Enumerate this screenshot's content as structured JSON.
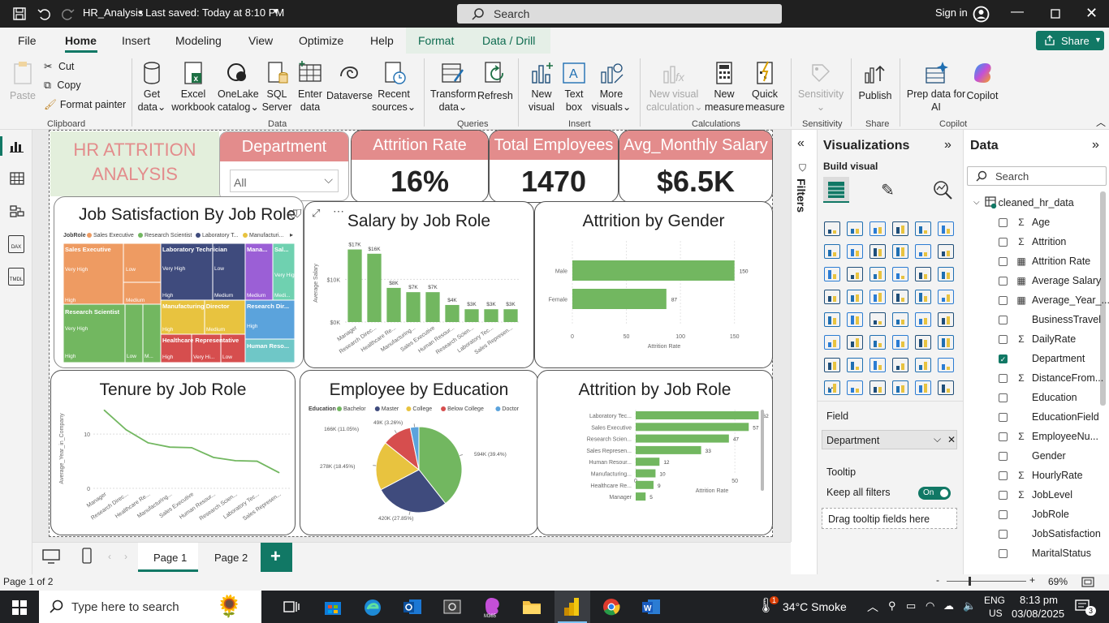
{
  "app": {
    "title": "HR_Analysis",
    "saved": "• Last saved: Today at 8:10 PM",
    "search": "Search",
    "signin": "Sign in"
  },
  "menu": {
    "file": "File",
    "home": "Home",
    "insert": "Insert",
    "modeling": "Modeling",
    "view": "View",
    "optimize": "Optimize",
    "help": "Help",
    "format": "Format",
    "datadrill": "Data / Drill",
    "share": "Share"
  },
  "ribbon": {
    "paste": "Paste",
    "cut": "Cut",
    "copy": "Copy",
    "format_painter": "Format painter",
    "clipboard": "Clipboard",
    "get_data_1": "Get",
    "get_data_2": "data",
    "excel_1": "Excel",
    "excel_2": "workbook",
    "onelake_1": "OneLake",
    "onelake_2": "catalog",
    "sql_1": "SQL",
    "sql_2": "Server",
    "enter_1": "Enter",
    "enter_2": "data",
    "dataverse": "Dataverse",
    "recent_1": "Recent",
    "recent_2": "sources",
    "data": "Data",
    "transform_1": "Transform",
    "transform_2": "data",
    "refresh": "Refresh",
    "queries": "Queries",
    "newvis_1": "New",
    "newvis_2": "visual",
    "textbox_1": "Text",
    "textbox_2": "box",
    "morevis_1": "More",
    "morevis_2": "visuals",
    "insert": "Insert",
    "newcalc_1": "New visual",
    "newcalc_2": "calculation",
    "newmeas_1": "New",
    "newmeas_2": "measure",
    "quickmeas_1": "Quick",
    "quickmeas_2": "measure",
    "calculations": "Calculations",
    "sensitivity": "Sensitivity",
    "sensitivity_grp": "Sensitivity",
    "publish": "Publish",
    "share_grp": "Share",
    "prep_1": "Prep data for",
    "prep_2": "AI",
    "copilot_btn": "Copilot",
    "copilot_grp": "Copilot"
  },
  "report": {
    "title_1": "HR ATTRITION",
    "title_2": "ANALYSIS",
    "dept_header": "Department",
    "dept_value": "All",
    "kpis": [
      {
        "label": "Attrition Rate",
        "value": "16%"
      },
      {
        "label": "Total Employees",
        "value": "1470"
      },
      {
        "label": "Avg_Monthly Salary",
        "value": "$6.5K"
      }
    ],
    "treemap": {
      "title": "Job Satisfaction By Job Role",
      "legend_label": "JobRole",
      "legend": [
        "Sales Executive",
        "Research Scientist",
        "Laboratory T...",
        "Manufacturi..."
      ],
      "labels": {
        "se": "Sales Executive",
        "lt": "Laboratory Technician",
        "ma": "Mana...",
        "sa": "Sal...",
        "rs": "Research Scientist",
        "md": "Manufacturing Director",
        "hr": "Healthcare Representative",
        "rd": "Research Dir...",
        "hu": "Human Reso...",
        "vh": "Very High",
        "lo": "Low",
        "hi": "High",
        "me": "Medium",
        "m": "M...",
        "vhl": "Very Hi...",
        "medi": "Medi..."
      }
    },
    "salary": {
      "title": "Salary by Job Role",
      "ylabel": "Average Salary",
      "yticks": [
        "$0K",
        "$10K"
      ]
    },
    "gender": {
      "title": "Attrition by Gender",
      "xlabel": "Attrition Rate",
      "xticks": [
        "0",
        "50",
        "100",
        "150"
      ]
    },
    "tenure": {
      "title": "Tenure by Job Role",
      "ylabel": "Average_Year_in_Company",
      "yticks": [
        "0",
        "10"
      ]
    },
    "education": {
      "title": "Employee by Education",
      "legend_label": "Education",
      "legend": [
        "Bachelor",
        "Master",
        "College",
        "Below College",
        "Doctor"
      ]
    },
    "jobattr": {
      "title": "Attrition by Job Role",
      "xlabel": "Attrition Rate",
      "xticks": [
        "0",
        "50"
      ]
    }
  },
  "chart_data": [
    {
      "type": "bar",
      "title": "Salary by Job Role",
      "ylabel": "Average Salary",
      "categories": [
        "Manager",
        "Research Direc...",
        "Healthcare Re...",
        "Manufacturing...",
        "Sales Executive",
        "Human Resour...",
        "Research Scien...",
        "Laboratory Tec...",
        "Sales Represen..."
      ],
      "values": [
        17,
        16,
        8,
        7,
        7,
        4,
        3,
        3,
        3
      ],
      "data_labels": [
        "$17K",
        "$16K",
        "$8K",
        "$7K",
        "$7K",
        "$4K",
        "$3K",
        "$3K",
        "$3K"
      ],
      "ylim": [
        0,
        19
      ]
    },
    {
      "type": "bar",
      "orientation": "horizontal",
      "title": "Attrition by Gender",
      "xlabel": "Attrition Rate",
      "categories": [
        "Male",
        "Female"
      ],
      "values": [
        150,
        87
      ],
      "xlim": [
        0,
        160
      ]
    },
    {
      "type": "line",
      "title": "Tenure by Job Role",
      "ylabel": "Average_Year_in_Company",
      "categories": [
        "Manager",
        "Research Direc...",
        "Healthcare Re...",
        "Manufacturing...",
        "Sales Executive",
        "Human Resour...",
        "Research Scien...",
        "Laboratory Tec...",
        "Sales Represen..."
      ],
      "values": [
        14.4,
        10.8,
        8.4,
        7.6,
        7.5,
        5.7,
        5.1,
        5.0,
        2.9
      ],
      "ylim": [
        0,
        16
      ]
    },
    {
      "type": "pie",
      "title": "Employee by Education",
      "categories": [
        "Bachelor",
        "Master",
        "College",
        "Below College",
        "Doctor"
      ],
      "values": [
        594,
        420,
        278,
        166,
        49
      ],
      "data_labels": [
        "594K (39.4%)",
        "420K (27.85%)",
        "278K (18.45%)",
        "166K (11.05%)",
        "49K (3.26%)"
      ],
      "colors": [
        "#72b760",
        "#3f4b7d",
        "#e8c33f",
        "#d64e4e",
        "#5ba3dc"
      ]
    },
    {
      "type": "bar",
      "orientation": "horizontal",
      "title": "Attrition by Job Role",
      "xlabel": "Attrition Rate",
      "categories": [
        "Laboratory Tec...",
        "Sales Executive",
        "Research Scien...",
        "Sales Represen...",
        "Human Resour...",
        "Manufacturing...",
        "Healthcare Re...",
        "Manager"
      ],
      "values": [
        62,
        57,
        47,
        33,
        12,
        10,
        9,
        5
      ],
      "xlim": [
        0,
        70
      ]
    }
  ],
  "filters": {
    "label": "Filters"
  },
  "viz": {
    "title": "Visualizations",
    "build": "Build visual",
    "field_label": "Field",
    "field_value": "Department",
    "tooltip": "Tooltip",
    "keep": "Keep all filters",
    "toggle": "On",
    "drag": "Drag tooltip fields here",
    "more": "..."
  },
  "datapane": {
    "title": "Data",
    "search": "Search",
    "table": "cleaned_hr_data",
    "fields": [
      {
        "n": "Age",
        "s": "Σ",
        "c": false
      },
      {
        "n": "Attrition",
        "s": "Σ",
        "c": false
      },
      {
        "n": "Attrition Rate",
        "s": "▦",
        "c": false
      },
      {
        "n": "Average Salary",
        "s": "▦",
        "c": false
      },
      {
        "n": "Average_Year_...",
        "s": "▦",
        "c": false
      },
      {
        "n": "BusinessTravel",
        "s": "",
        "c": false
      },
      {
        "n": "DailyRate",
        "s": "Σ",
        "c": false
      },
      {
        "n": "Department",
        "s": "",
        "c": true
      },
      {
        "n": "DistanceFrom...",
        "s": "Σ",
        "c": false
      },
      {
        "n": "Education",
        "s": "",
        "c": false
      },
      {
        "n": "EducationField",
        "s": "",
        "c": false
      },
      {
        "n": "EmployeeNu...",
        "s": "Σ",
        "c": false
      },
      {
        "n": "Gender",
        "s": "",
        "c": false
      },
      {
        "n": "HourlyRate",
        "s": "Σ",
        "c": false
      },
      {
        "n": "JobLevel",
        "s": "Σ",
        "c": false
      },
      {
        "n": "JobRole",
        "s": "",
        "c": false
      },
      {
        "n": "JobSatisfaction",
        "s": "",
        "c": false
      },
      {
        "n": "MaritalStatus",
        "s": "",
        "c": false
      }
    ]
  },
  "pages": {
    "p1": "Page 1",
    "p2": "Page 2",
    "add": "+"
  },
  "status": {
    "page": "Page 1 of 2",
    "zoom": "69%",
    "minus": "-",
    "plus": "+"
  },
  "taskbar": {
    "search": "Type here to search",
    "weather": "34°C  Smoke",
    "lang1": "ENG",
    "lang2": "US",
    "time": "8:13 pm",
    "date": "03/08/2025",
    "notif": "3"
  }
}
